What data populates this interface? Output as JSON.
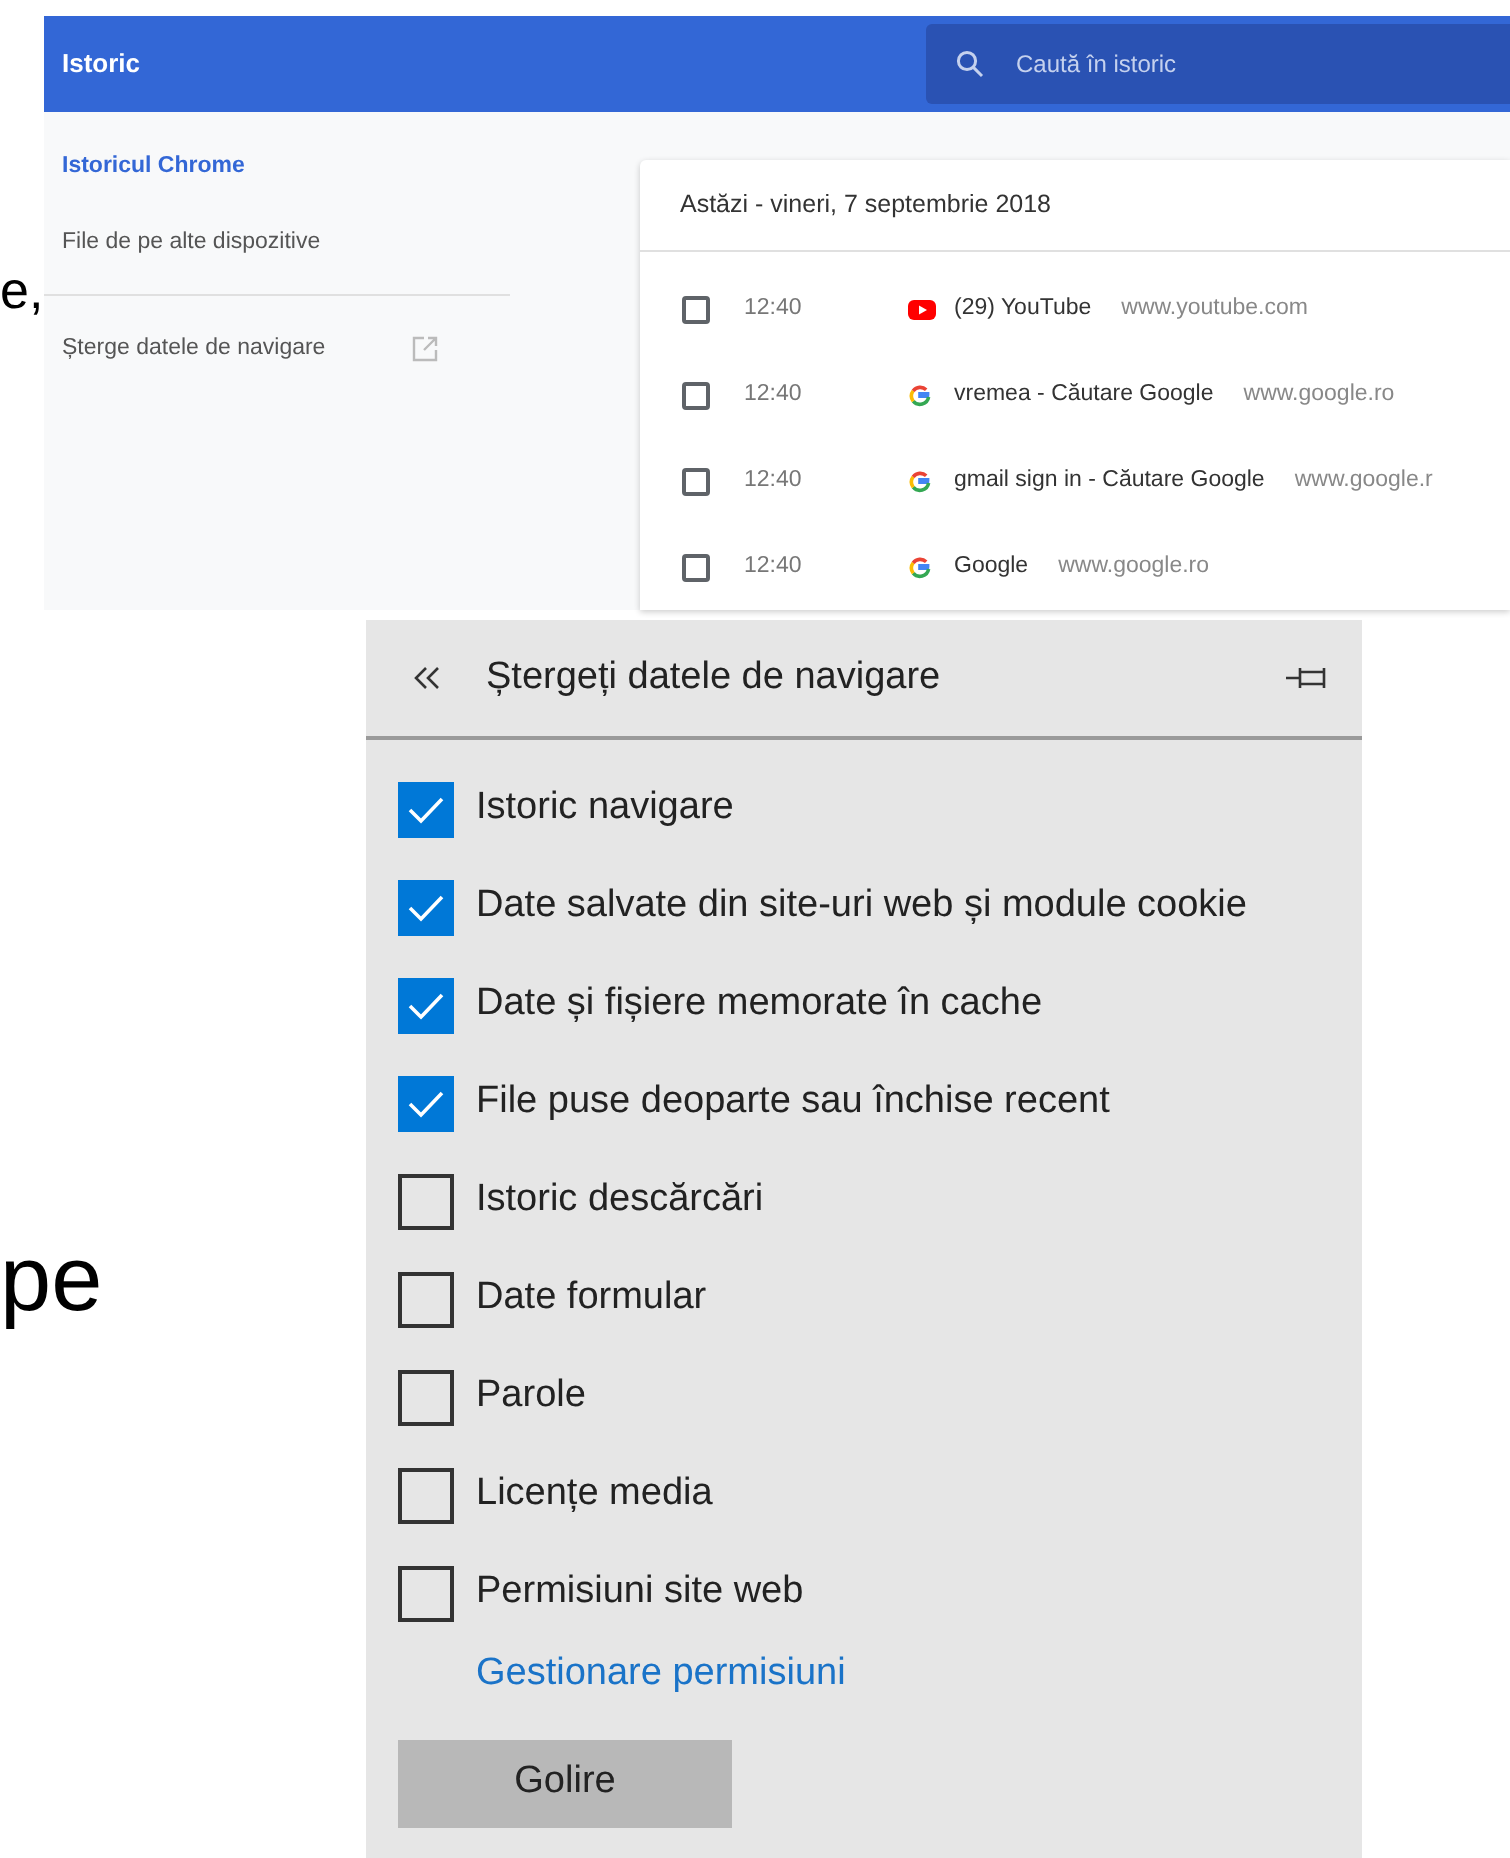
{
  "background_text": [
    "e,",
    "pe"
  ],
  "history_window": {
    "title": "Istoric",
    "search": {
      "placeholder": "Caută în istoric"
    },
    "sidebar": {
      "items": [
        {
          "label": "Istoricul Chrome",
          "selected": true
        },
        {
          "label": "File de pe alte dispozitive",
          "selected": false
        }
      ],
      "clear_link": "Șterge datele de navigare"
    },
    "date_heading": "Astăzi - vineri, 7 septembrie 2018",
    "entries": [
      {
        "checked": false,
        "time": "12:40",
        "kind": "youtube",
        "title": "(29) YouTube",
        "domain": "www.youtube.com"
      },
      {
        "checked": false,
        "time": "12:40",
        "kind": "google",
        "title": "vremea - Căutare Google",
        "domain": "www.google.ro"
      },
      {
        "checked": false,
        "time": "12:40",
        "kind": "google",
        "title": "gmail sign in - Căutare Google",
        "domain": "www.google.r"
      },
      {
        "checked": false,
        "time": "12:40",
        "kind": "google",
        "title": "Google",
        "domain": "www.google.ro"
      }
    ]
  },
  "clear_panel": {
    "title": "Ștergeți datele de navigare",
    "options": [
      {
        "label": "Istoric navigare",
        "checked": true
      },
      {
        "label": "Date salvate din site-uri web și module cookie",
        "checked": true
      },
      {
        "label": "Date și fișiere memorate în cache",
        "checked": true
      },
      {
        "label": "File puse deoparte sau închise recent",
        "checked": true
      },
      {
        "label": "Istoric descărcări",
        "checked": false
      },
      {
        "label": "Date formular",
        "checked": false
      },
      {
        "label": "Parole",
        "checked": false
      },
      {
        "label": "Licențe media",
        "checked": false
      },
      {
        "label": "Permisiuni site web",
        "checked": false
      }
    ],
    "manage_link": "Gestionare permisiuni",
    "button": "Golire"
  }
}
